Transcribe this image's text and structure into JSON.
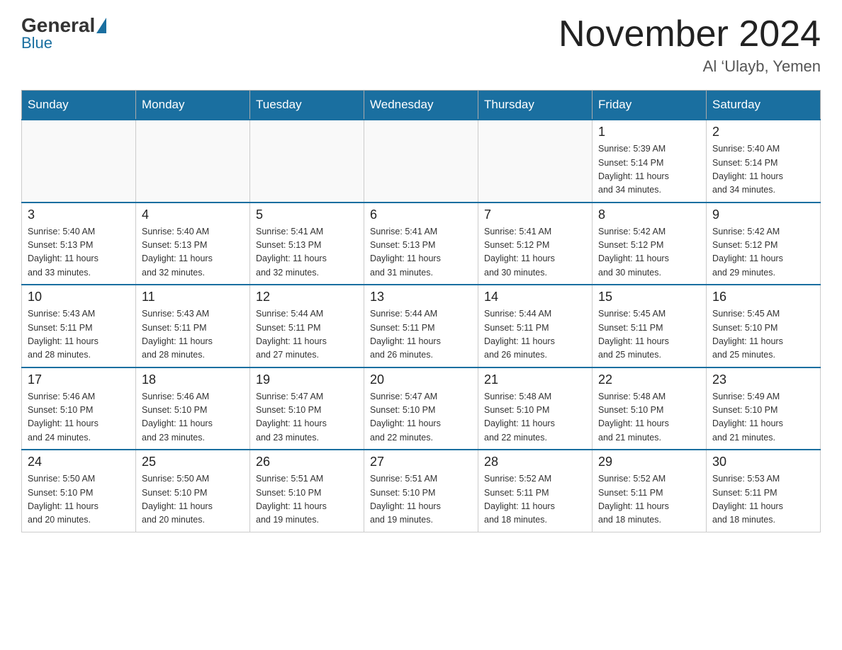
{
  "header": {
    "logo_general": "General",
    "logo_blue": "Blue",
    "title": "November 2024",
    "subtitle": "Al ‘Ulayb, Yemen"
  },
  "weekdays": [
    "Sunday",
    "Monday",
    "Tuesday",
    "Wednesday",
    "Thursday",
    "Friday",
    "Saturday"
  ],
  "weeks": [
    [
      {
        "day": "",
        "info": ""
      },
      {
        "day": "",
        "info": ""
      },
      {
        "day": "",
        "info": ""
      },
      {
        "day": "",
        "info": ""
      },
      {
        "day": "",
        "info": ""
      },
      {
        "day": "1",
        "info": "Sunrise: 5:39 AM\nSunset: 5:14 PM\nDaylight: 11 hours\nand 34 minutes."
      },
      {
        "day": "2",
        "info": "Sunrise: 5:40 AM\nSunset: 5:14 PM\nDaylight: 11 hours\nand 34 minutes."
      }
    ],
    [
      {
        "day": "3",
        "info": "Sunrise: 5:40 AM\nSunset: 5:13 PM\nDaylight: 11 hours\nand 33 minutes."
      },
      {
        "day": "4",
        "info": "Sunrise: 5:40 AM\nSunset: 5:13 PM\nDaylight: 11 hours\nand 32 minutes."
      },
      {
        "day": "5",
        "info": "Sunrise: 5:41 AM\nSunset: 5:13 PM\nDaylight: 11 hours\nand 32 minutes."
      },
      {
        "day": "6",
        "info": "Sunrise: 5:41 AM\nSunset: 5:13 PM\nDaylight: 11 hours\nand 31 minutes."
      },
      {
        "day": "7",
        "info": "Sunrise: 5:41 AM\nSunset: 5:12 PM\nDaylight: 11 hours\nand 30 minutes."
      },
      {
        "day": "8",
        "info": "Sunrise: 5:42 AM\nSunset: 5:12 PM\nDaylight: 11 hours\nand 30 minutes."
      },
      {
        "day": "9",
        "info": "Sunrise: 5:42 AM\nSunset: 5:12 PM\nDaylight: 11 hours\nand 29 minutes."
      }
    ],
    [
      {
        "day": "10",
        "info": "Sunrise: 5:43 AM\nSunset: 5:11 PM\nDaylight: 11 hours\nand 28 minutes."
      },
      {
        "day": "11",
        "info": "Sunrise: 5:43 AM\nSunset: 5:11 PM\nDaylight: 11 hours\nand 28 minutes."
      },
      {
        "day": "12",
        "info": "Sunrise: 5:44 AM\nSunset: 5:11 PM\nDaylight: 11 hours\nand 27 minutes."
      },
      {
        "day": "13",
        "info": "Sunrise: 5:44 AM\nSunset: 5:11 PM\nDaylight: 11 hours\nand 26 minutes."
      },
      {
        "day": "14",
        "info": "Sunrise: 5:44 AM\nSunset: 5:11 PM\nDaylight: 11 hours\nand 26 minutes."
      },
      {
        "day": "15",
        "info": "Sunrise: 5:45 AM\nSunset: 5:11 PM\nDaylight: 11 hours\nand 25 minutes."
      },
      {
        "day": "16",
        "info": "Sunrise: 5:45 AM\nSunset: 5:10 PM\nDaylight: 11 hours\nand 25 minutes."
      }
    ],
    [
      {
        "day": "17",
        "info": "Sunrise: 5:46 AM\nSunset: 5:10 PM\nDaylight: 11 hours\nand 24 minutes."
      },
      {
        "day": "18",
        "info": "Sunrise: 5:46 AM\nSunset: 5:10 PM\nDaylight: 11 hours\nand 23 minutes."
      },
      {
        "day": "19",
        "info": "Sunrise: 5:47 AM\nSunset: 5:10 PM\nDaylight: 11 hours\nand 23 minutes."
      },
      {
        "day": "20",
        "info": "Sunrise: 5:47 AM\nSunset: 5:10 PM\nDaylight: 11 hours\nand 22 minutes."
      },
      {
        "day": "21",
        "info": "Sunrise: 5:48 AM\nSunset: 5:10 PM\nDaylight: 11 hours\nand 22 minutes."
      },
      {
        "day": "22",
        "info": "Sunrise: 5:48 AM\nSunset: 5:10 PM\nDaylight: 11 hours\nand 21 minutes."
      },
      {
        "day": "23",
        "info": "Sunrise: 5:49 AM\nSunset: 5:10 PM\nDaylight: 11 hours\nand 21 minutes."
      }
    ],
    [
      {
        "day": "24",
        "info": "Sunrise: 5:50 AM\nSunset: 5:10 PM\nDaylight: 11 hours\nand 20 minutes."
      },
      {
        "day": "25",
        "info": "Sunrise: 5:50 AM\nSunset: 5:10 PM\nDaylight: 11 hours\nand 20 minutes."
      },
      {
        "day": "26",
        "info": "Sunrise: 5:51 AM\nSunset: 5:10 PM\nDaylight: 11 hours\nand 19 minutes."
      },
      {
        "day": "27",
        "info": "Sunrise: 5:51 AM\nSunset: 5:10 PM\nDaylight: 11 hours\nand 19 minutes."
      },
      {
        "day": "28",
        "info": "Sunrise: 5:52 AM\nSunset: 5:11 PM\nDaylight: 11 hours\nand 18 minutes."
      },
      {
        "day": "29",
        "info": "Sunrise: 5:52 AM\nSunset: 5:11 PM\nDaylight: 11 hours\nand 18 minutes."
      },
      {
        "day": "30",
        "info": "Sunrise: 5:53 AM\nSunset: 5:11 PM\nDaylight: 11 hours\nand 18 minutes."
      }
    ]
  ]
}
